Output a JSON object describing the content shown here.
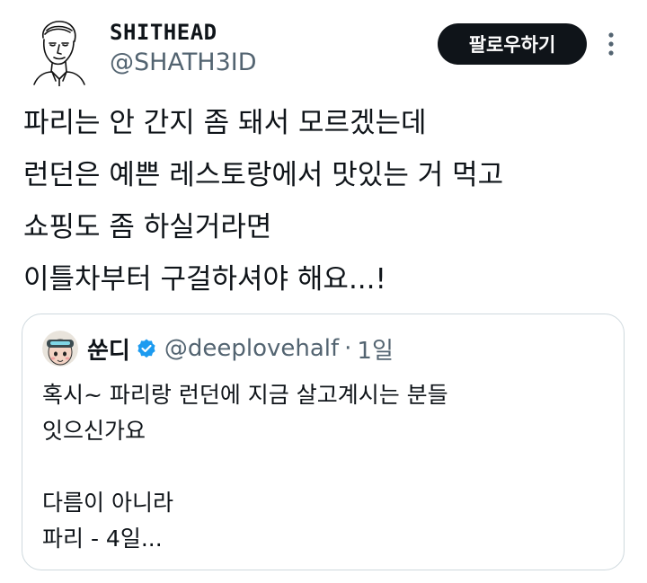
{
  "tweet": {
    "author": {
      "display_name": "SHITHEAD",
      "handle": "@SHATH3ID",
      "avatar_icon": "line-drawing-portrait-icon"
    },
    "follow_label": "팔로우하기",
    "more_icon": "more-vertical-icon",
    "lines": [
      "파리는 안 간지 좀 돼서 모르겠는데",
      "런던은 예쁜 레스토랑에서 맛있는 거 먹고",
      "쇼핑도 좀 하실거라면",
      "이틀차부터 구걸하셔야 해요...!"
    ]
  },
  "quote": {
    "author": {
      "display_name": "쑨디",
      "handle": "@deeplovehalf",
      "verified": true,
      "avatar_icon": "cartoon-face-avatar-icon"
    },
    "separator": "·",
    "time": "1일",
    "lines": [
      "혹시~ 파리랑 런던에 지금 살고계시는 분들",
      "잇으신가요",
      "",
      "다름이 아니라",
      "파리 - 4일..."
    ]
  },
  "colors": {
    "text_primary": "#0f1419",
    "text_secondary": "#536471",
    "button_bg": "#0f1419",
    "verified_blue": "#1d9bf0",
    "border": "#cfd9de"
  }
}
